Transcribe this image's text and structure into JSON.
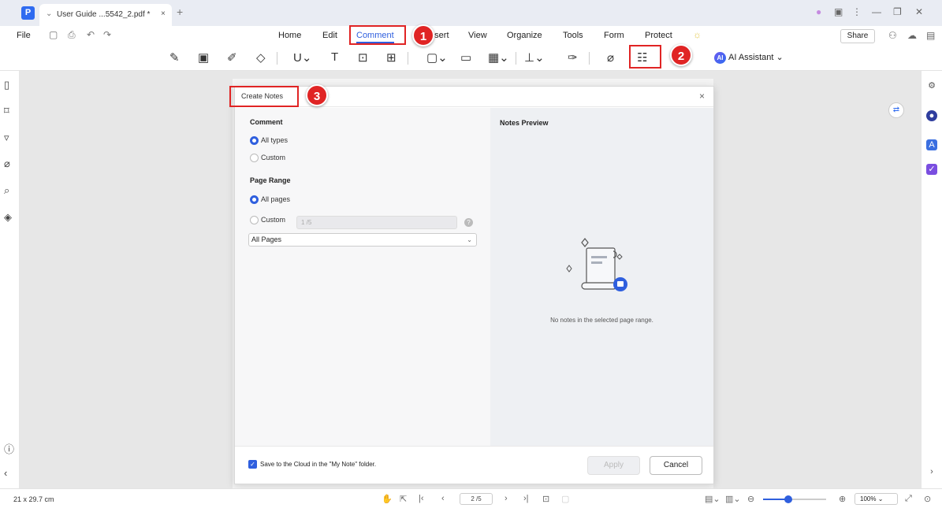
{
  "app": {
    "logo_letter": "P",
    "tab_title": "User Guide ...5542_2.pdf *",
    "tab_close": "×",
    "new_tab": "+",
    "window_controls": [
      "●",
      "▣",
      "⋮",
      "—",
      "❐",
      "✕"
    ]
  },
  "menu": {
    "file": "File",
    "items": [
      "Home",
      "Edit",
      "Comment",
      "Insert",
      "View",
      "Organize",
      "Tools",
      "Form",
      "Protect"
    ],
    "active": "Comment",
    "share": "Share"
  },
  "toolbar": {
    "ai_assistant": "AI Assistant",
    "ai_badge": "AI"
  },
  "dialog": {
    "title": "Create Notes",
    "close": "×",
    "comment_section": "Comment",
    "comment_options": [
      "All types",
      "Custom"
    ],
    "page_range_section": "Page Range",
    "page_range_options": [
      "All pages",
      "Custom"
    ],
    "custom_page_placeholder": "1 /5",
    "page_select_value": "All Pages",
    "preview_title": "Notes Preview",
    "empty_message": "No notes in the selected page range.",
    "cloud_checkbox_label": "Save to the Cloud in the \"My Note\" folder.",
    "apply": "Apply",
    "cancel": "Cancel"
  },
  "callouts": [
    "1",
    "2",
    "3"
  ],
  "status": {
    "page_size": "21 x 29.7 cm",
    "page_indicator": "2 /5",
    "zoom": "100%",
    "zoom_level": 0.4
  },
  "colors": {
    "accent": "#2f5fde",
    "callout": "#e02424"
  }
}
